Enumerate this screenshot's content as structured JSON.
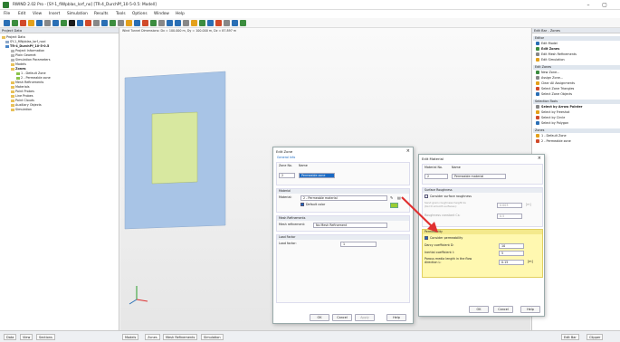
{
  "window": {
    "title": "RWIND 2.02 Pro - [SY-1_fiWpblas_lorf_no] [TR-4_DurchPf_10-5-0.5: Modell]",
    "minimize": "–",
    "maximize": "▢"
  },
  "menu": [
    "File",
    "Edit",
    "View",
    "Insert",
    "Simulation",
    "Results",
    "Tools",
    "Options",
    "Window",
    "Help"
  ],
  "toolbar_colors": [
    "#2a6fb5",
    "#3c8d3f",
    "#d14a2a",
    "#e4a11b",
    "#2a6fb5",
    "#888",
    "#2a6fb5",
    "#3c8d3f",
    "#1a1a1a",
    "#2a6fb5",
    "#d14a2a",
    "#888",
    "#2a6fb5",
    "#3c8d3f",
    "#888",
    "#e4a11b",
    "#2a6fb5",
    "#d14a2a",
    "#3c8d3f",
    "#888",
    "#2a6fb5",
    "#2a6fb5",
    "#888",
    "#e4a11b",
    "#3c8d3f",
    "#2a6fb5",
    "#d14a2a",
    "#888",
    "#2a6fb5",
    "#3c8d3f"
  ],
  "navigator": {
    "header": "Project Data",
    "items": [
      {
        "label": "Project Data",
        "icon": "folder-icon"
      },
      {
        "label": "SY-1_fiWpblas_lorf_noci",
        "icon": "file-icon"
      },
      {
        "label": "TR-4_DurchPf_10-5-0.5",
        "icon": "model-icon"
      },
      {
        "label": "Project Information",
        "icon": "doc-icon"
      },
      {
        "label": "Plain Geomet",
        "icon": "doc-icon"
      },
      {
        "label": "Simulation Parameters",
        "icon": "doc-icon"
      },
      {
        "label": "Models",
        "icon": "folder-icon"
      },
      {
        "label": "Zones",
        "icon": "folder-icon"
      },
      {
        "label": "1 - Default Zone",
        "icon": "zone-icon"
      },
      {
        "label": "2 - Permeable zone",
        "icon": "zone-icon"
      },
      {
        "label": "Mesh Refinements",
        "icon": "folder-icon"
      },
      {
        "label": "Materials",
        "icon": "folder-icon"
      },
      {
        "label": "Point Probes",
        "icon": "folder-icon"
      },
      {
        "label": "Line Probes",
        "icon": "folder-icon"
      },
      {
        "label": "Point Clouds",
        "icon": "folder-icon"
      },
      {
        "label": "Auxiliary Objects",
        "icon": "folder-icon"
      },
      {
        "label": "Simulation",
        "icon": "folder-icon"
      }
    ]
  },
  "viewport": {
    "info": "Wind Tunnel Dimensions: Dx = 100.000 m, Dy = 100.000 m, Dz = 87.897 m"
  },
  "right_panel": {
    "header": "Edit Bar - Zones",
    "sections": [
      {
        "title": "Editor",
        "items": [
          "Edit Model",
          "Edit Zones",
          "Edit Mesh Refinements",
          "Edit Simulation"
        ]
      },
      {
        "title": "Edit Zones",
        "items": [
          "New Zone...",
          "Assign Zone...",
          "Clear All Assignments",
          "Select Zone Triangles",
          "Select Zone Objects"
        ]
      },
      {
        "title": "Selection Tools",
        "items": [
          "Select by Arrow Pointer",
          "Select by Freeshot",
          "Select by Circle",
          "Select by Polygon"
        ]
      },
      {
        "title": "Zones",
        "items": [
          "1 - Default Zone",
          "2 - Permeable zone"
        ]
      }
    ]
  },
  "edit_zone": {
    "title": "Edit Zone",
    "tabs": [
      "General",
      "Info"
    ],
    "zone_no_label": "Zone No.",
    "name_label": "Name",
    "zone_no": "2",
    "name": "Permeable zone",
    "material_head": "Material",
    "material_label": "Material:",
    "material_value": "2 - Permeable material",
    "default_color": "Default color",
    "mesh_head": "Mesh Refinements",
    "mesh_label": "Mesh refinement:",
    "mesh_value": "No Mesh Refinement",
    "load_head": "Load Factor",
    "load_label": "Load factor:",
    "load_value": "1",
    "ok": "OK",
    "cancel": "Cancel",
    "apply": "Apply",
    "help": "Help"
  },
  "edit_material": {
    "title": "Edit Material",
    "no_label": "Material No.",
    "name_label": "Name",
    "no": "2",
    "name": "Permeable material",
    "surface_head": "Surface Roughness",
    "consider_roughness": "Consider surface roughness",
    "sand_label": "Sand grain roughness height ks (Ks=0 smooth surfaces):",
    "sand_value": "0.003",
    "sand_unit": "[m]",
    "rough_const_label": "Roughness constant Cs:",
    "rough_const_value": "0.5",
    "perm_head": "Permeability",
    "consider_perm": "Consider permeability",
    "darcy_label": "Darcy coefficient D:",
    "darcy_value": "10",
    "inertial_label": "Inertial coefficient I:",
    "inertial_value": "5",
    "porous_label": "Porous media length in the flow direction L:",
    "porous_value": "0.15",
    "porous_unit": "[m]",
    "ok": "OK",
    "cancel": "Cancel",
    "help": "Help"
  },
  "bottom_tabs": {
    "left": [
      "Data",
      "View",
      "Sections"
    ],
    "center": [
      "Models",
      "Zones",
      "Mesh Refinements",
      "Simulation"
    ],
    "right": [
      "Edit Bar",
      "Clipper"
    ]
  },
  "colors": {
    "accent": "#1a6ac4",
    "highlight": "#fff8b0",
    "wall": "#a8c4e6",
    "zone": "#d8e8a0",
    "arrow": "#e03030"
  }
}
